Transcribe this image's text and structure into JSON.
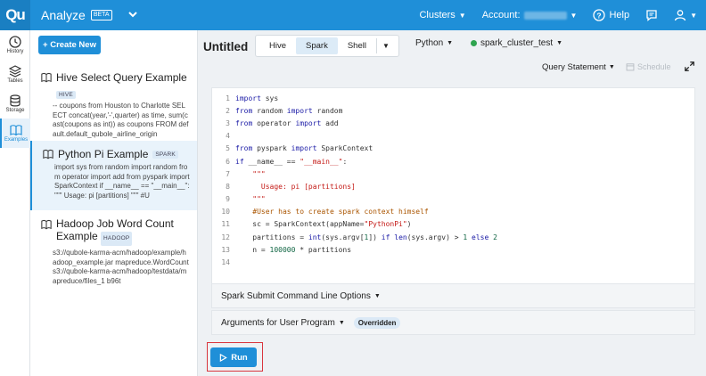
{
  "app": {
    "logo": "Qu",
    "title": "Analyze",
    "beta": "BETA"
  },
  "topnav": {
    "clusters_label": "Clusters",
    "account_label": "Account:",
    "help_label": "Help"
  },
  "rail": {
    "items": [
      {
        "label": "History",
        "icon": "clock-icon"
      },
      {
        "label": "Tables",
        "icon": "layers-icon"
      },
      {
        "label": "Storage",
        "icon": "database-icon"
      },
      {
        "label": "Examples",
        "icon": "book-icon",
        "active": true
      }
    ]
  },
  "panel": {
    "create_label": "+ Create New",
    "examples": [
      {
        "title": "Hive Select Query Example",
        "badge": "HIVE",
        "desc": "-- coupons from Houston to Charlotte SELECT concat(year,'-',quarter) as time, sum(cast(coupons as int)) as coupons FROM default.default_qubole_airline_origin"
      },
      {
        "title": "Python Pi Example",
        "badge": "SPARK",
        "desc": "import sys from random import random from operator import add from pyspark import SparkContext if __name__ == \"__main__\": \"\"\" Usage: pi [partitions] \"\"\" #U"
      },
      {
        "title": "Hadoop Job Word Count Example",
        "badge": "HADOOP",
        "desc": "s3://qubole-karma-acm/hadoop/example/hadoop_example.jar mapreduce.WordCount s3://qubole-karma-acm/hadoop/testdata/mapreduce/files_1 b96t"
      }
    ]
  },
  "main": {
    "title": "Untitled",
    "tabs": [
      "Hive",
      "Spark",
      "Shell"
    ],
    "active_tab": "Spark",
    "language": "Python",
    "cluster": "spark_cluster_test",
    "query_statement": "Query Statement",
    "schedule": "Schedule",
    "code_lines": [
      "import sys",
      "from random import random",
      "from operator import add",
      "",
      "from pyspark import SparkContext",
      "if __name__ == \"__main__\":",
      "    \"\"\"",
      "      Usage: pi [partitions]",
      "    \"\"\"",
      "    #User has to create spark context himself",
      "    sc = SparkContext(appName=\"PythonPi\")",
      "    partitions = int(sys.argv[1]) if len(sys.argv) > 1 else 2",
      "    n = 100000 * partitions",
      ""
    ],
    "spark_submit_label": "Spark Submit Command Line Options",
    "arguments_label": "Arguments for User Program",
    "overridden_label": "Overridden",
    "run_label": "Run"
  },
  "colors": {
    "primary": "#1f8fd8",
    "highlight": "#d9363e",
    "cluster_status": "#2ea44f"
  }
}
